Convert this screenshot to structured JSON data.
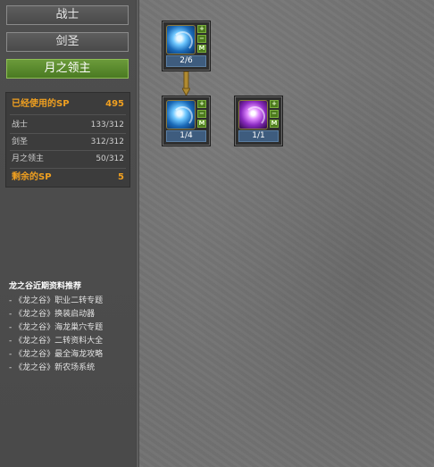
{
  "tabs": [
    {
      "label": "战士",
      "active": false
    },
    {
      "label": "剑圣",
      "active": false
    },
    {
      "label": "月之领主",
      "active": true
    }
  ],
  "sp_panel": {
    "used_label": "已经使用的SP",
    "used_value": "495",
    "rows": [
      {
        "label": "战士",
        "value": "133/312"
      },
      {
        "label": "剑圣",
        "value": "312/312"
      },
      {
        "label": "月之领主",
        "value": "50/312"
      }
    ],
    "remaining_label": "剩余的SP",
    "remaining_value": "5"
  },
  "links": {
    "title": "龙之谷近期资料推荐",
    "items": [
      "- 《龙之谷》职业二转专题",
      "- 《龙之谷》换装启动器",
      "- 《龙之谷》海龙巢穴专题",
      "- 《龙之谷》二转资料大全",
      "- 《龙之谷》最全海龙攻略",
      "- 《龙之谷》新农场系统"
    ]
  },
  "skills": [
    {
      "level": "2/6",
      "icon": "blue-swirl-icon",
      "btn_plus": "+",
      "btn_minus": "−",
      "btn_max": "M"
    },
    {
      "level": "1/4",
      "icon": "blue-swirl-icon",
      "btn_plus": "+",
      "btn_minus": "−",
      "btn_max": "M"
    },
    {
      "level": "1/1",
      "icon": "purple-swirl-icon",
      "btn_plus": "+",
      "btn_minus": "−",
      "btn_max": "M"
    }
  ],
  "colors": {
    "active_tab": "#5a8a2c",
    "sp_highlight": "#f0a020",
    "level_bar": "#3e5c7e"
  }
}
